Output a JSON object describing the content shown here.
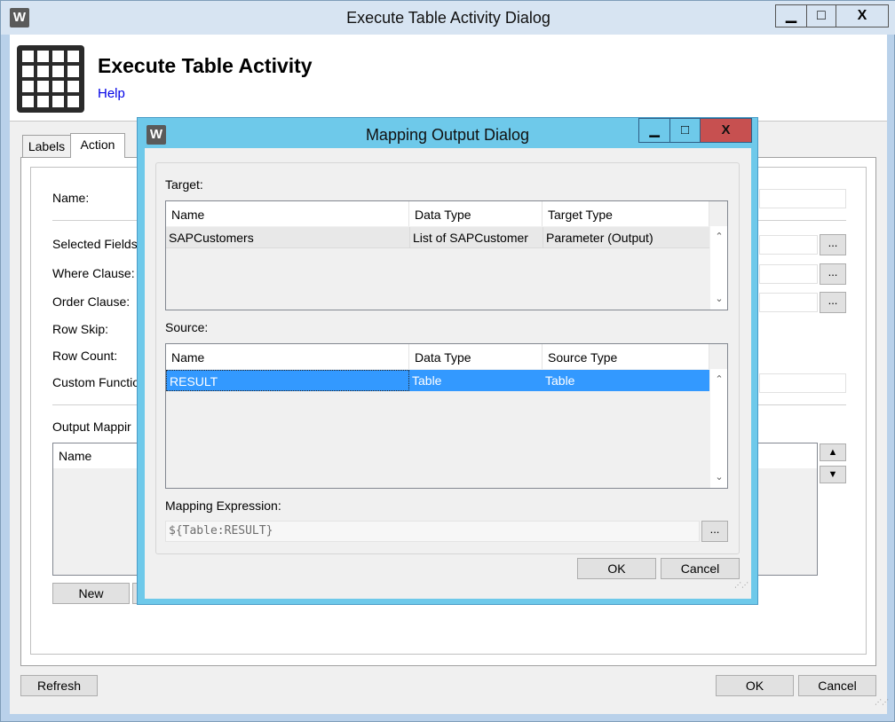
{
  "outer": {
    "logo": "W",
    "title": "Execute Table Activity Dialog",
    "controls": {
      "minimize": "▁",
      "maximize": "□",
      "close": "X"
    },
    "header_title": "Execute Table Activity",
    "help_label": "Help",
    "tabs": [
      {
        "label": "Labels"
      },
      {
        "label": "Action"
      }
    ],
    "fields": {
      "name": "Name:",
      "selected_fields": "Selected Fields",
      "where_clause": "Where Clause:",
      "order_clause": "Order Clause:",
      "row_skip": "Row Skip:",
      "row_count": "Row Count:",
      "custom_function": "Custom Functio"
    },
    "output_mapping": {
      "label": "Output Mappir",
      "column_name": "Name"
    },
    "browse_label": "...",
    "new_label": "New",
    "refresh_label": "Refresh",
    "ok_label": "OK",
    "cancel_label": "Cancel"
  },
  "dialog": {
    "logo": "W",
    "title": "Mapping Output Dialog",
    "controls": {
      "minimize": "▁",
      "maximize": "□",
      "close": "X"
    },
    "target": {
      "label": "Target:",
      "columns": [
        "Name",
        "Data Type",
        "Target Type"
      ],
      "rows": [
        [
          "SAPCustomers",
          "List of SAPCustomer",
          "Parameter (Output)"
        ]
      ]
    },
    "source": {
      "label": "Source:",
      "columns": [
        "Name",
        "Data Type",
        "Source Type"
      ],
      "rows": [
        [
          "RESULT",
          "Table",
          "Table"
        ]
      ],
      "selected_row": 0
    },
    "mapping_expression": {
      "label": "Mapping Expression:",
      "value": "${Table:RESULT}"
    },
    "browse_label": "...",
    "ok_label": "OK",
    "cancel_label": "Cancel"
  },
  "colors": {
    "dialog_frame": "#6ec9ea",
    "close_button": "#c75050",
    "selection": "#3399ff",
    "link": "#0000e6"
  },
  "icons": {
    "app": "w-logo-icon",
    "header": "table-grid-icon",
    "scroll_up": "chevron-up-icon",
    "scroll_down": "chevron-down-icon",
    "move_up": "triangle-up-icon",
    "move_down": "triangle-down-icon"
  }
}
